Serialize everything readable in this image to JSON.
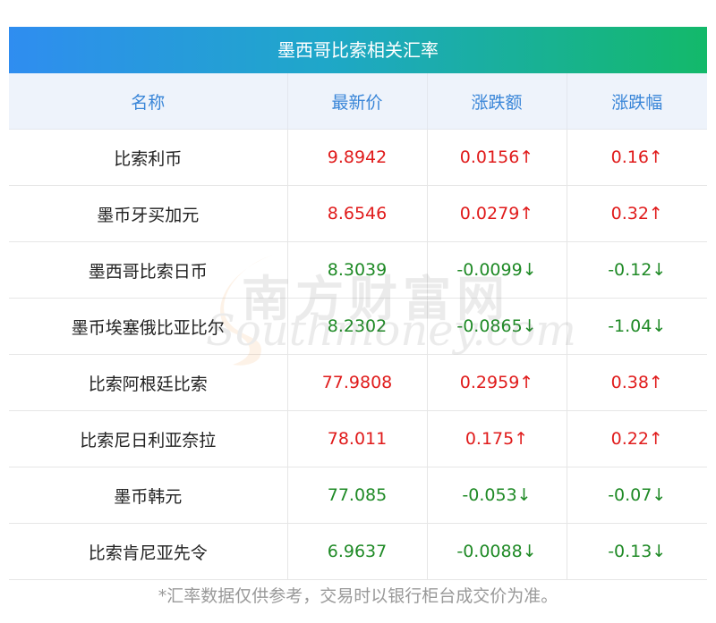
{
  "title": "墨西哥比索相关汇率",
  "headers": [
    "名称",
    "最新价",
    "涨跌额",
    "涨跌幅"
  ],
  "rows": [
    {
      "name": "比索利币",
      "price": "9.8942",
      "change": "0.0156↑",
      "pct": "0.16↑",
      "dir": "up"
    },
    {
      "name": "墨币牙买加元",
      "price": "8.6546",
      "change": "0.0279↑",
      "pct": "0.32↑",
      "dir": "up"
    },
    {
      "name": "墨西哥比索日币",
      "price": "8.3039",
      "change": "-0.0099↓",
      "pct": "-0.12↓",
      "dir": "down"
    },
    {
      "name": "墨币埃塞俄比亚比尔",
      "price": "8.2302",
      "change": "-0.0865↓",
      "pct": "-1.04↓",
      "dir": "down"
    },
    {
      "name": "比索阿根廷比索",
      "price": "77.9808",
      "change": "0.2959↑",
      "pct": "0.38↑",
      "dir": "up"
    },
    {
      "name": "比索尼日利亚奈拉",
      "price": "78.011",
      "change": "0.175↑",
      "pct": "0.22↑",
      "dir": "up"
    },
    {
      "name": "墨币韩元",
      "price": "77.085",
      "change": "-0.053↓",
      "pct": "-0.07↓",
      "dir": "down"
    },
    {
      "name": "比索肯尼亚先令",
      "price": "6.9637",
      "change": "-0.0088↓",
      "pct": "-0.13↓",
      "dir": "down"
    }
  ],
  "footnote": "*汇率数据仅供参考，交易时以银行柜台成交价为准。",
  "watermark": {
    "cn": "南方财富网",
    "en": "Southmoney.com"
  },
  "colors": {
    "up": "#e01b1b",
    "down": "#1f8a26",
    "header_text": "#3a86d8",
    "title_start": "#2f8df0",
    "title_end": "#13b96a"
  }
}
